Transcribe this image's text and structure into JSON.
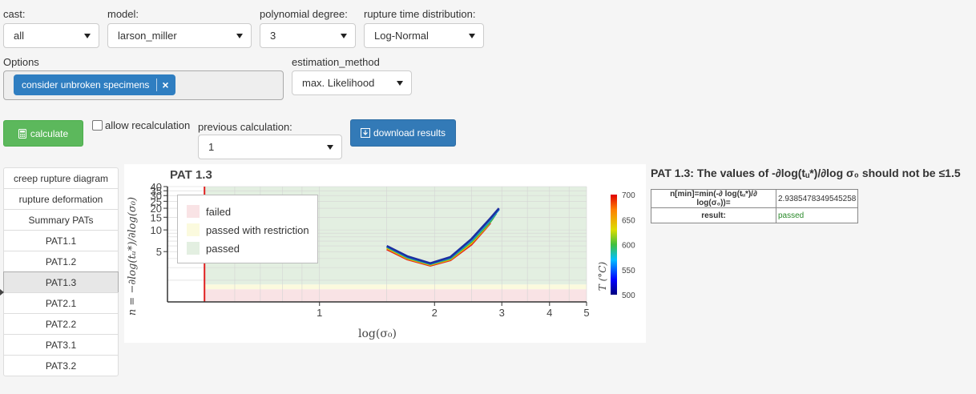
{
  "controls": {
    "cast": {
      "label": "cast:",
      "value": "all"
    },
    "model": {
      "label": "model:",
      "value": "larson_miller"
    },
    "degree": {
      "label": "polynomial degree:",
      "value": "3"
    },
    "distribution": {
      "label": "rupture time distribution:",
      "value": "Log-Normal"
    },
    "options": {
      "label": "Options",
      "chips": [
        "consider unbroken specimens"
      ],
      "remove": "×"
    },
    "estimation": {
      "label": "estimation_method",
      "value": "max. Likelihood"
    },
    "calculate_label": "calculate",
    "allow_recalc_label": "allow recalculation",
    "allow_recalc_checked": false,
    "previous": {
      "label": "previous calculation:",
      "value": "1"
    },
    "download_label": "download results"
  },
  "nav": {
    "items": [
      "creep rupture diagram",
      "rupture deformation",
      "Summary PATs",
      "PAT1.1",
      "PAT1.2",
      "PAT1.3",
      "PAT2.1",
      "PAT2.2",
      "PAT3.1",
      "PAT3.2"
    ],
    "active": "PAT1.3"
  },
  "result": {
    "title": "PAT 1.3: The values of -∂log(tᵤ*)/∂log σ₀ should not be ≤1.5",
    "rows": [
      {
        "key": "n[min]=min(-∂ log(tᵤ*)/∂ log(σ₀))=",
        "value": "2.9385478349545258"
      },
      {
        "key": "result:",
        "value": "passed"
      }
    ]
  },
  "colors": {
    "failed": "#f9e3e5",
    "restricted": "#fbfade",
    "passed": "#e3efe1",
    "limit_line": "#e02020",
    "primary": "#337ab7",
    "success": "#5cb85c"
  },
  "chart_data": {
    "type": "line",
    "title": "PAT 1.3",
    "xlabel": "log(σ₀)",
    "ylabel": "n = −∂log(tᵤ*)/∂log(σ₀)",
    "x_scale": "log",
    "y_scale": "log",
    "xlim": [
      0.4,
      5
    ],
    "ylim": [
      1,
      40
    ],
    "x_ticks": [
      1,
      2,
      3,
      4,
      5
    ],
    "y_tick_labels": [
      "5",
      "10",
      "15",
      "20",
      "25",
      "30",
      "35",
      "40"
    ],
    "y_tick_values": [
      5,
      10,
      15,
      20,
      25,
      30,
      35,
      40
    ],
    "vline_x": 0.5,
    "bands": [
      {
        "name": "failed",
        "from": 1,
        "to": 1.5
      },
      {
        "name": "passed with restriction",
        "from": 1.5,
        "to": 1.75
      },
      {
        "name": "passed",
        "from": 1.75,
        "to": 40
      }
    ],
    "legend": [
      "failed",
      "passed with restriction",
      "passed"
    ],
    "legend_placement": "top-left",
    "colorbar": {
      "label": "T (°C)",
      "range": [
        500,
        700
      ],
      "ticks": [
        "500",
        "550",
        "600",
        "650",
        "700"
      ],
      "tick_values": [
        500,
        550,
        600,
        650,
        700
      ]
    },
    "series": [
      {
        "T": 500,
        "x": [
          1.5,
          1.7,
          1.95,
          2.2,
          2.5,
          2.8,
          2.95
        ],
        "y": [
          6.0,
          4.3,
          3.45,
          4.2,
          7.5,
          14.5,
          20.0
        ]
      },
      {
        "T": 550,
        "x": [
          1.5,
          1.7,
          1.95,
          2.2,
          2.5,
          2.8,
          2.95
        ],
        "y": [
          5.9,
          4.2,
          3.4,
          4.1,
          7.2,
          13.8,
          19.3
        ]
      },
      {
        "T": 600,
        "x": [
          1.5,
          1.7,
          1.95,
          2.2,
          2.5,
          2.8,
          2.9
        ],
        "y": [
          5.8,
          4.1,
          3.35,
          4.0,
          6.9,
          13.0,
          17.0
        ]
      },
      {
        "T": 650,
        "x": [
          1.5,
          1.7,
          1.95,
          2.2,
          2.5,
          2.75,
          2.85
        ],
        "y": [
          5.6,
          4.0,
          3.28,
          3.9,
          6.6,
          11.5,
          14.8
        ]
      },
      {
        "T": 700,
        "x": [
          1.5,
          1.7,
          1.95,
          2.2,
          2.5,
          2.7,
          2.8
        ],
        "y": [
          5.4,
          3.9,
          3.2,
          3.8,
          6.3,
          10.0,
          12.5
        ]
      }
    ]
  }
}
